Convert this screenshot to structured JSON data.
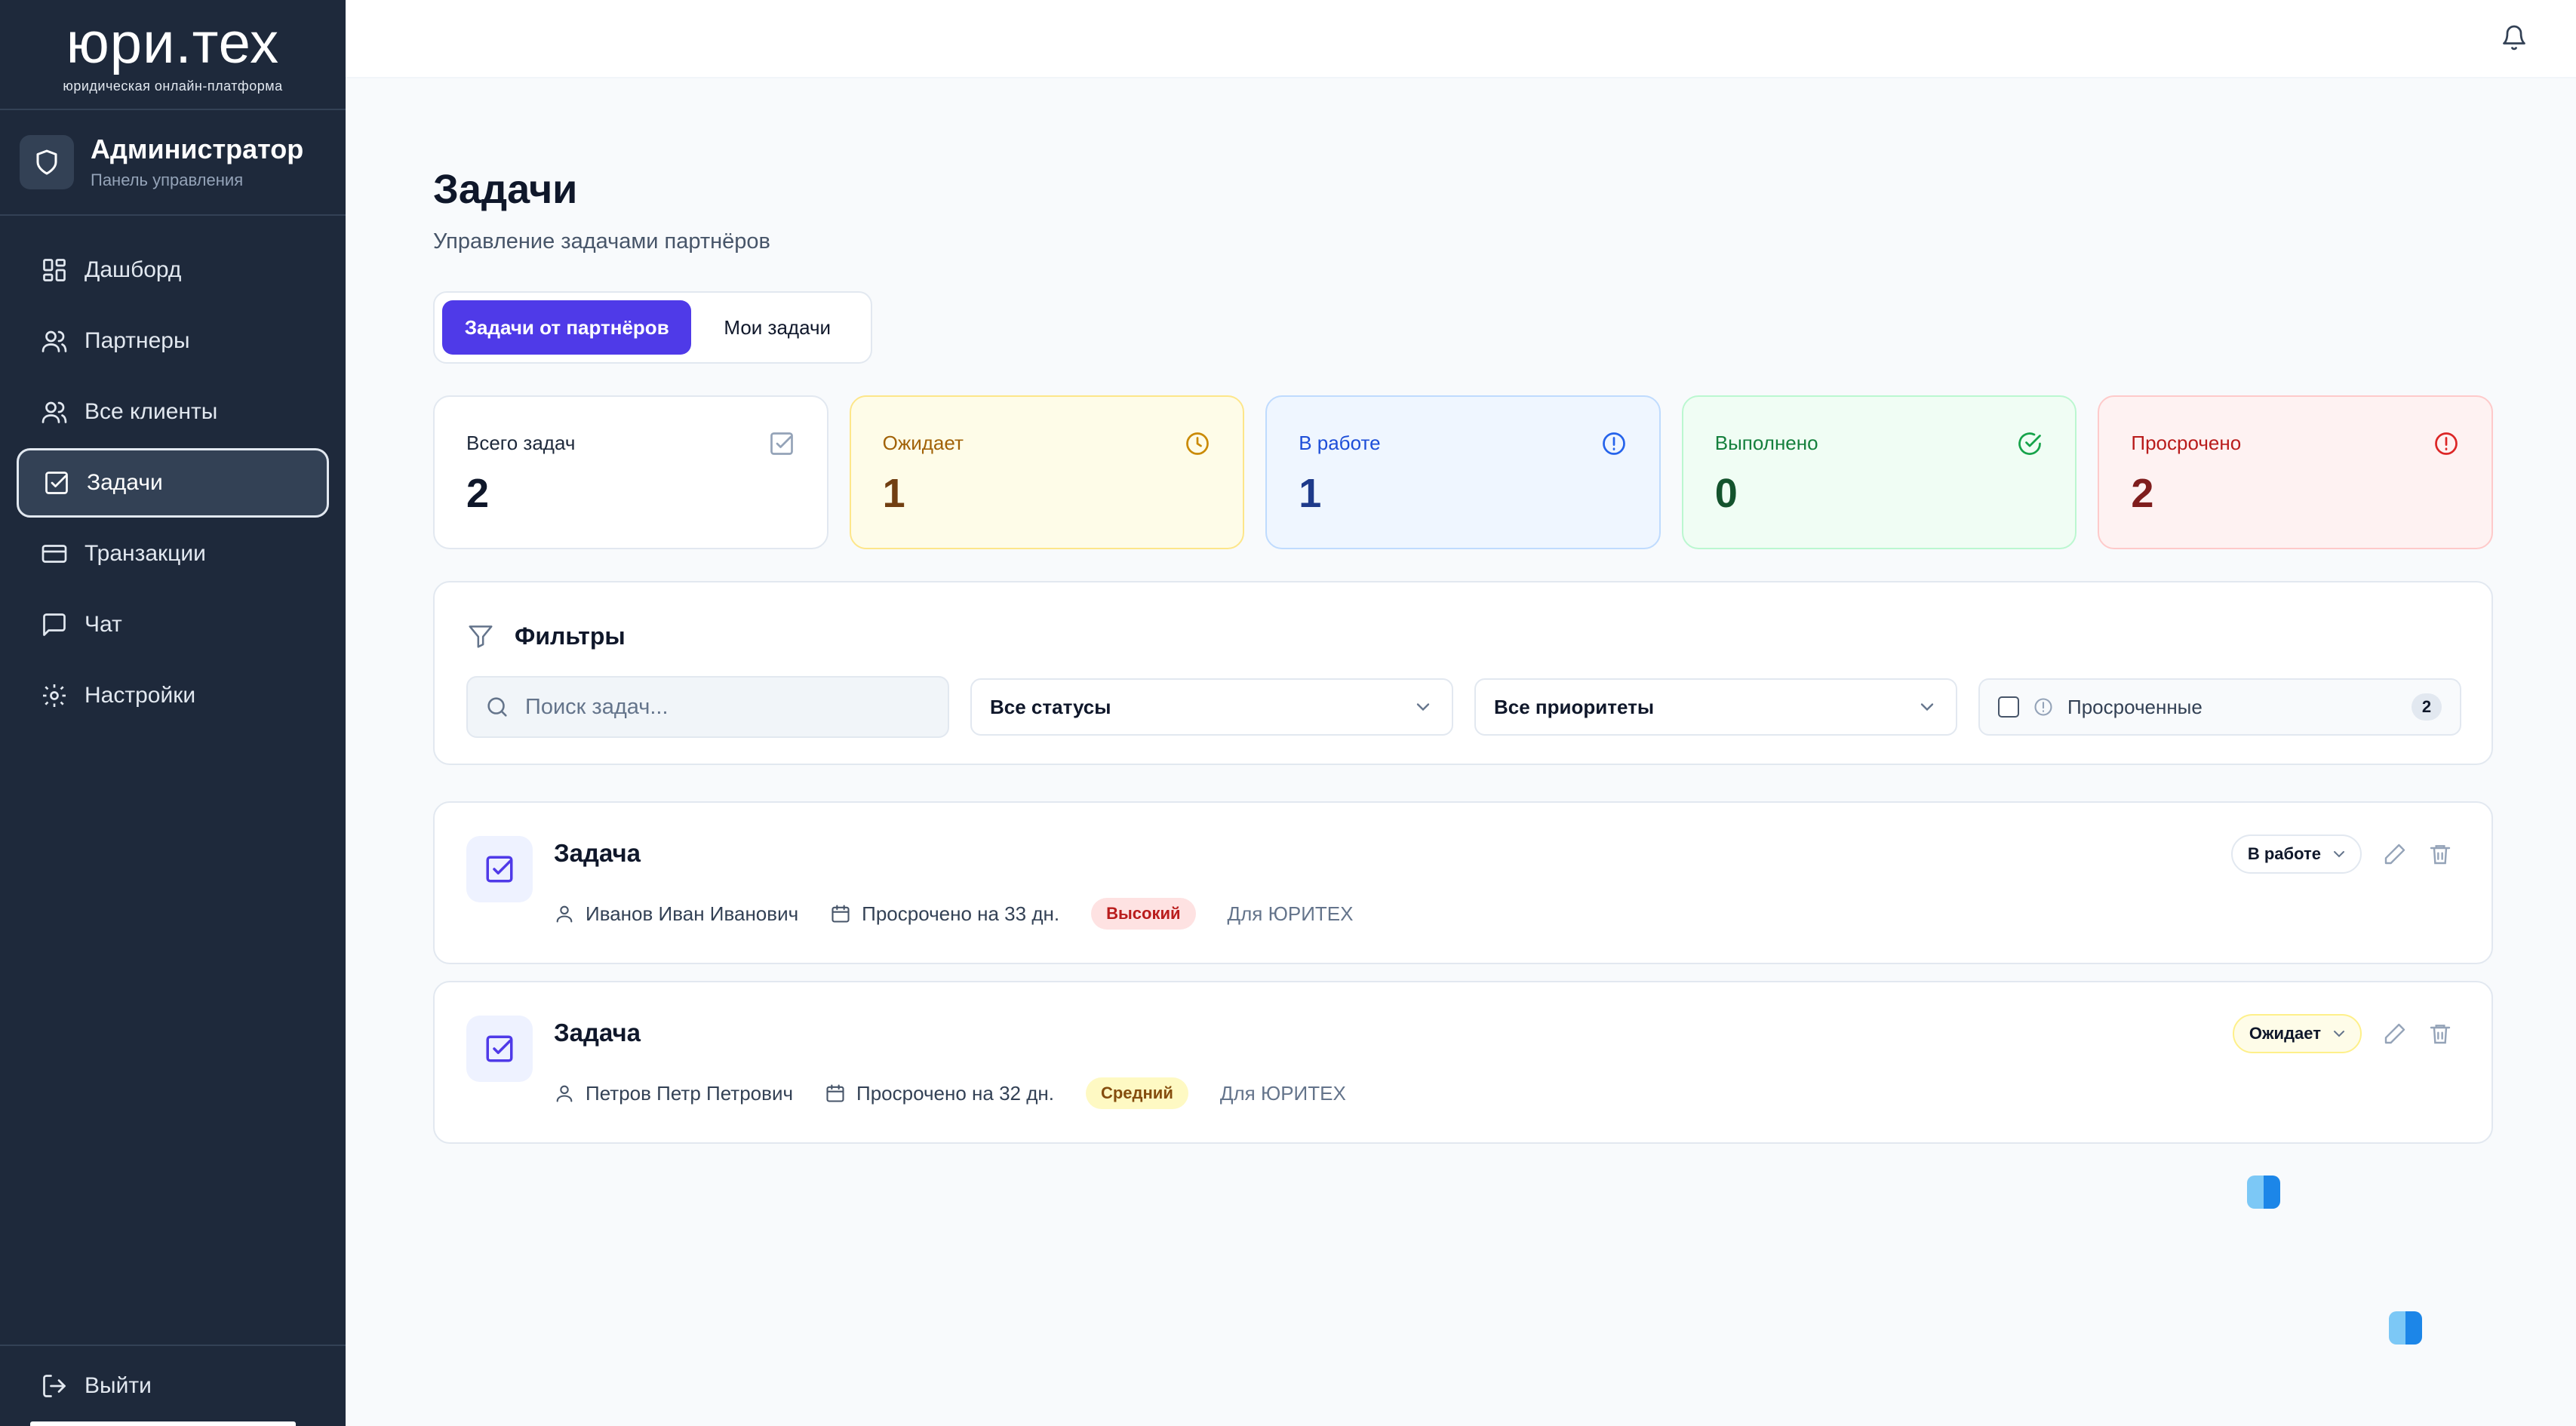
{
  "brand": {
    "logo": "юри.тех",
    "tagline": "юридическая онлайн-платформа"
  },
  "admin": {
    "title": "Администратор",
    "subtitle": "Панель управления"
  },
  "nav": [
    {
      "label": "Дашборд",
      "icon": "dashboard-icon"
    },
    {
      "label": "Партнеры",
      "icon": "users-icon"
    },
    {
      "label": "Все клиенты",
      "icon": "users-icon"
    },
    {
      "label": "Задачи",
      "icon": "checkbox-icon",
      "active": true
    },
    {
      "label": "Транзакции",
      "icon": "card-icon"
    },
    {
      "label": "Чат",
      "icon": "chat-icon"
    },
    {
      "label": "Настройки",
      "icon": "gear-icon"
    }
  ],
  "logout_label": "Выйти",
  "page": {
    "title": "Задачи",
    "subtitle": "Управление задачами партнёров"
  },
  "tabs": [
    {
      "label": "Задачи от партнёров",
      "active": true
    },
    {
      "label": "Мои задачи",
      "active": false
    }
  ],
  "stats": [
    {
      "label": "Всего задач",
      "value": "2",
      "icon": "checkbox-icon"
    },
    {
      "label": "Ожидает",
      "value": "1",
      "icon": "clock-icon",
      "color": "#ca8a04"
    },
    {
      "label": "В работе",
      "value": "1",
      "icon": "alert-circle-icon",
      "color": "#2563eb"
    },
    {
      "label": "Выполнено",
      "value": "0",
      "icon": "check-circle-icon",
      "color": "#16a34a"
    },
    {
      "label": "Просрочено",
      "value": "2",
      "icon": "alert-circle-icon",
      "color": "#dc2626"
    }
  ],
  "filters": {
    "title": "Фильтры",
    "search_placeholder": "Поиск задач...",
    "status_value": "Все статусы",
    "priority_value": "Все приоритеты",
    "overdue_label": "Просроченные",
    "overdue_count": "2"
  },
  "tasks": [
    {
      "title": "Задача",
      "assignee": "Иванов Иван Иванович",
      "due": "Просрочено на 33 дн.",
      "priority": "Высокий",
      "for": "Для ЮРИТЕХ",
      "status": "В работе"
    },
    {
      "title": "Задача",
      "assignee": "Петров Петр Петрович",
      "due": "Просрочено на 32 дн.",
      "priority": "Средний",
      "for": "Для ЮРИТЕХ",
      "status": "Ожидает"
    }
  ],
  "colors": {
    "accent": "#4f3ae8",
    "sidebar": "#1e293b"
  }
}
